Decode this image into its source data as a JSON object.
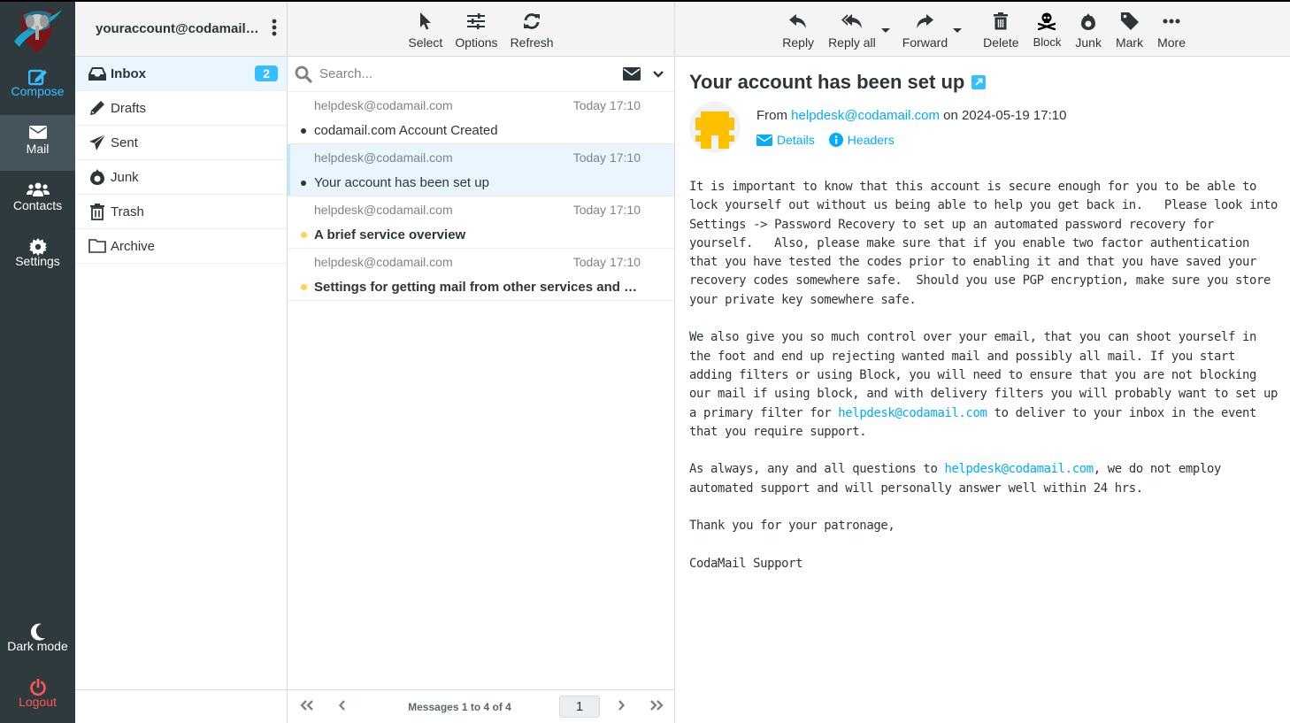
{
  "taskmenu": {
    "compose": "Compose",
    "mail": "Mail",
    "contacts": "Contacts",
    "settings": "Settings",
    "dark_mode": "Dark mode",
    "logout": "Logout"
  },
  "account": "youraccount@codamail.c...",
  "folders": [
    {
      "name": "Inbox",
      "icon": "inbox-icon",
      "unread": "2",
      "selected": true
    },
    {
      "name": "Drafts",
      "icon": "pencil-icon"
    },
    {
      "name": "Sent",
      "icon": "paper-plane-icon"
    },
    {
      "name": "Junk",
      "icon": "fire-icon"
    },
    {
      "name": "Trash",
      "icon": "trash-icon"
    },
    {
      "name": "Archive",
      "icon": "folder-icon"
    }
  ],
  "list_toolbar": {
    "select": "Select",
    "options": "Options",
    "refresh": "Refresh"
  },
  "search": {
    "placeholder": "Search...",
    "value": ""
  },
  "messages": [
    {
      "from": "helpdesk@codamail.com",
      "date": "Today 17:10",
      "subject": "codamail.com Account Created",
      "unread": false,
      "selected": false
    },
    {
      "from": "helpdesk@codamail.com",
      "date": "Today 17:10",
      "subject": "Your account has been set up",
      "unread": false,
      "selected": true
    },
    {
      "from": "helpdesk@codamail.com",
      "date": "Today 17:10",
      "subject": "A brief service overview",
      "unread": true,
      "selected": false
    },
    {
      "from": "helpdesk@codamail.com",
      "date": "Today 17:10",
      "subject": "Settings for getting mail from other services and ac...",
      "unread": true,
      "selected": false
    }
  ],
  "pager": {
    "count": "Messages 1 to 4 of 4",
    "page": "1"
  },
  "message_toolbar": {
    "reply": "Reply",
    "reply_all": "Reply all",
    "forward": "Forward",
    "delete": "Delete",
    "block": "Block",
    "junk": "Junk",
    "mark": "Mark",
    "more": "More"
  },
  "message": {
    "subject": "Your account has been set up",
    "from_label": "From",
    "from_address": "helpdesk@codamail.com",
    "on_label": "on",
    "date": "2024-05-19 17:10",
    "details": "Details",
    "headers": "Headers",
    "body": {
      "p1": "It is important to know that this account is secure enough for you to be able to lock yourself out without us being able to help you get back in.   Please look into Settings -> Password Recovery to set up an automated password recovery for yourself.   Also, please make sure that if you enable two factor authentication that you have tested the codes prior to enabling it and that you have saved your recovery codes somewhere safe.  Should you use PGP encryption, make sure you store your private key somewhere safe.",
      "p2_before": "We also give you so much control over your email, that you can shoot yourself in the foot and end up rejecting wanted mail and possibly all mail. If you start adding filters or using Block, you will need to ensure that you are not blocking our mail if using block, and with delivery filters you will probably want to set up a primary filter for ",
      "p2_link": "helpdesk@codamail.com",
      "p2_after": " to deliver to your inbox in the event that you require support.",
      "p3_before": "As always, any and all questions to ",
      "p3_link": "helpdesk@codamail.com",
      "p3_after": ", we do not employ automated support and will personally answer well within 24 hrs.",
      "p4": "Thank you for your patronage,",
      "p5": "CodaMail Support"
    }
  },
  "colors": {
    "accent": "#37beff",
    "link": "#00acff",
    "sidebar_bg": "#2f3a3f",
    "logout": "#ff5552",
    "unread_dot": "#ffd452",
    "selected_bg": "#e9f6fd"
  }
}
